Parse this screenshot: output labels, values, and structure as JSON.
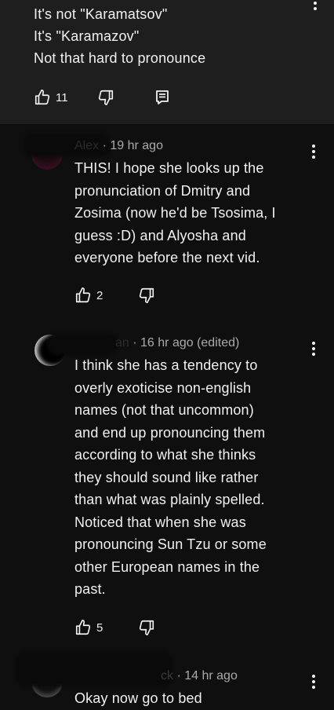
{
  "parent_comment": {
    "lines": [
      "It's not \"Karamatsov\"",
      "It's \"Karamazov\"",
      "Not that hard to pronounce"
    ],
    "like_count": "11",
    "icons": [
      "thumbs-up-icon",
      "thumbs-down-icon",
      "reply-icon",
      "more-icon"
    ]
  },
  "replies": [
    {
      "author_fragment": "Alex",
      "time": "· 19 hr ago",
      "lines": [
        "THIS! I hope she looks up the",
        "pronunciation of Dmitry and",
        "Zosima (now he'd be Tsosima, I",
        "guess :D) and Alyosha and",
        "everyone before the next vid."
      ],
      "like_count": "2"
    },
    {
      "author_fragment": "an",
      "time": "· 16 hr ago (edited)",
      "lines": [
        "I think she has a tendency to",
        "overly exoticise non-english",
        "names (not that uncommon)",
        "and end up pronouncing them",
        "according to what she thinks",
        "they should sound like rather",
        "than what was plainly spelled.",
        "Noticed that when she was",
        "pronouncing Sun Tzu or some",
        "other European names in the",
        "past."
      ],
      "like_count": "5"
    },
    {
      "author_fragment": "ck",
      "time": "· 14 hr ago",
      "lines": [
        "Okay now go to bed"
      ],
      "like_count": ""
    }
  ],
  "colors": {
    "background": "#0f0f0f",
    "highlight": "#1e1e1e",
    "text": "#f1f1f1",
    "meta": "#aaaaaa"
  }
}
